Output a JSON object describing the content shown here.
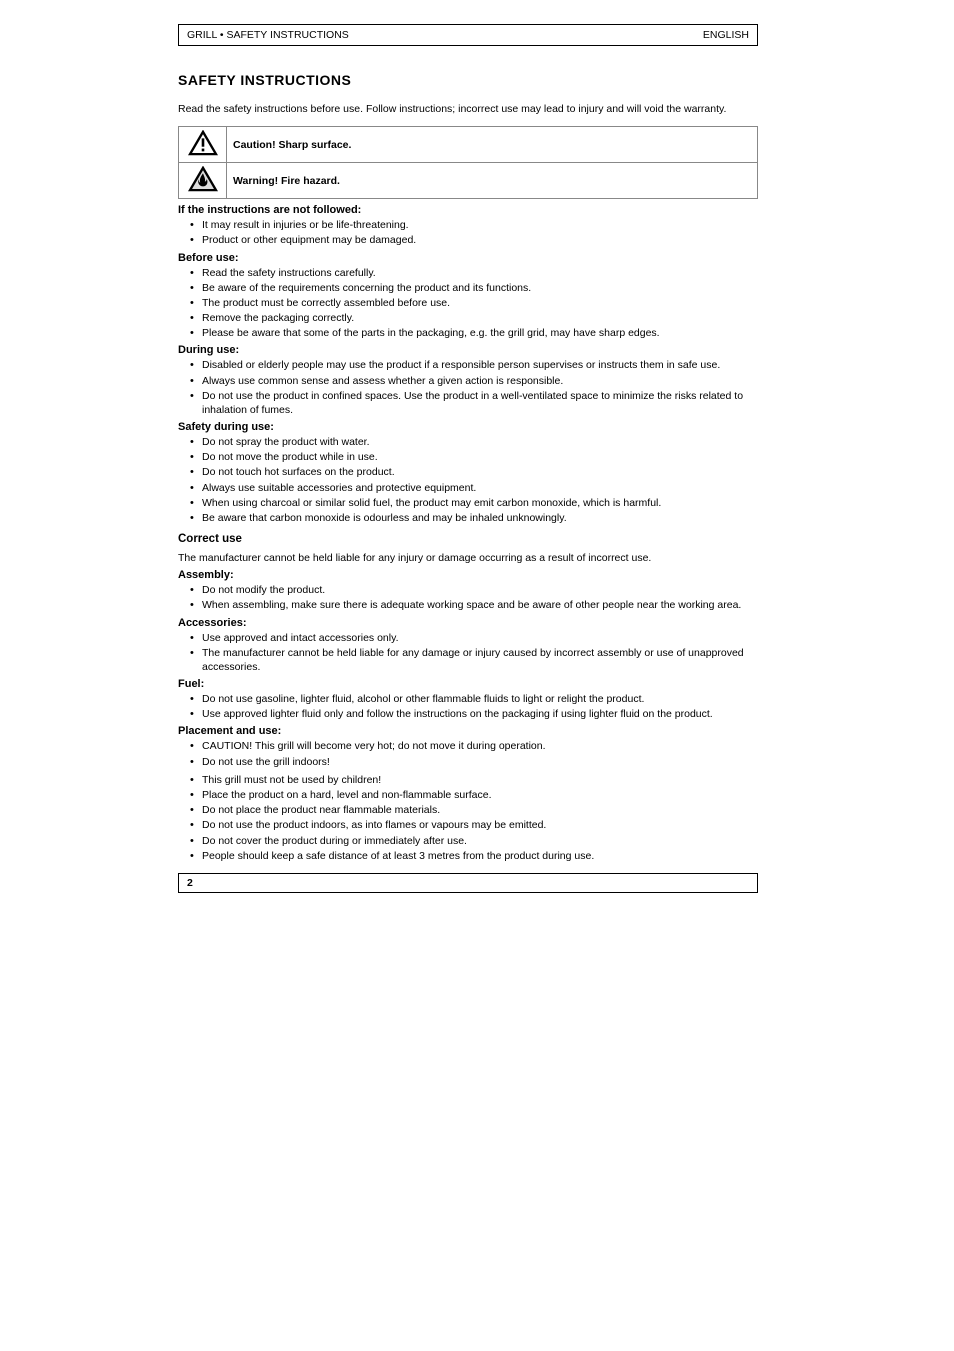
{
  "header": {
    "left": "GRILL • SAFETY INSTRUCTIONS",
    "right": "ENGLISH"
  },
  "section_title": "SAFETY INSTRUCTIONS",
  "intro": "Read the safety instructions before use. Follow instructions; incorrect use may lead to injury and will void the warranty.",
  "warn_rows": [
    {
      "icon": "caution",
      "text": "Caution! Sharp surface."
    },
    {
      "icon": "fire",
      "text": "Warning! Fire hazard."
    }
  ],
  "groups_a": [
    {
      "title": "If the instructions are not followed:",
      "items": [
        "It may result in injuries or be life-threatening.",
        "Product or other equipment may be damaged."
      ]
    },
    {
      "title": "Before use:",
      "items": [
        "Read the safety instructions carefully.",
        "Be aware of the requirements concerning the product and its functions.",
        "The product must be correctly assembled before use.",
        "Remove the packaging correctly.",
        "Please be aware that some of the parts in the packaging, e.g. the grill grid, may have sharp edges."
      ]
    },
    {
      "title": "During use:",
      "items": [
        "Disabled or elderly people may use the product if a responsible person supervises or instructs them in safe use.",
        "Always use common sense and assess whether a given action is responsible.",
        "Do not use the product in confined spaces. Use the product in a well-ventilated space to minimize the risks related to inhalation of fumes."
      ]
    },
    {
      "title": "Safety during use:",
      "items": [
        "Do not spray the product with water.",
        "Do not move the product while in use.",
        "Do not touch hot surfaces on the product.",
        "Always use suitable accessories and protective equipment.",
        "When using charcoal or similar solid fuel, the product may emit carbon monoxide, which is harmful.",
        "Be aware that carbon monoxide is odourless and may be inhaled unknowingly."
      ]
    }
  ],
  "subheader": "Correct use",
  "correct_use_intro": "The manufacturer cannot be held liable for any injury or damage occurring as a result of incorrect use.",
  "groups_b": [
    {
      "title": "Assembly:",
      "items": [
        "Do not modify the product.",
        "When assembling, make sure there is adequate working space and be aware of other people near the working area."
      ]
    },
    {
      "title": "Accessories:",
      "items": [
        "Use approved and intact accessories only.",
        "The manufacturer cannot be held liable for any damage or injury caused by incorrect assembly or use of unapproved accessories."
      ]
    },
    {
      "title": "Fuel:",
      "items": [
        "Do not use gasoline, lighter fluid, alcohol or other flammable fluids to light or relight the product.",
        "Use approved lighter fluid only and follow the instructions on the packaging if using lighter fluid on the product."
      ]
    },
    {
      "title": "Placement and use:",
      "items": [
        "CAUTION! This grill will become very hot; do not move it during operation.",
        "Do not use the grill indoors!"
      ]
    },
    {
      "title": "",
      "items": [
        "This grill must not be used by children!",
        "Place the product on a hard, level and non-flammable surface.",
        "Do not place the product near flammable materials.",
        "Do not use the product indoors, as into flames or vapours may be emitted.",
        "Do not cover the product during or immediately after use.",
        "People should keep a safe distance of at least 3 metres from the product during use."
      ]
    }
  ],
  "footer": {
    "left": "2",
    "right": ""
  }
}
